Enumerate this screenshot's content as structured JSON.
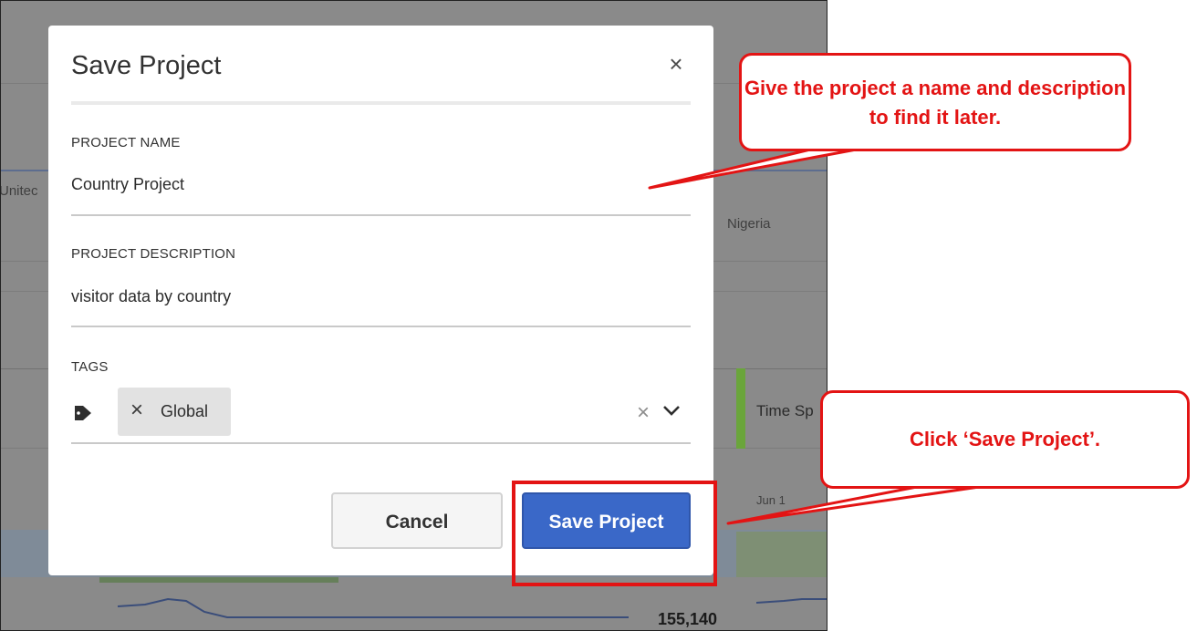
{
  "background": {
    "partial_country_label": "Unitec",
    "country_label": "Nigeria",
    "time_label": "Time Sp",
    "date_label": "Jun 1",
    "metric_value": "155,140"
  },
  "dialog": {
    "title": "Save Project",
    "close_icon": "close-icon",
    "project_name": {
      "label": "PROJECT NAME",
      "value": "Country Project"
    },
    "project_description": {
      "label": "PROJECT DESCRIPTION",
      "value": "visitor data by country"
    },
    "tags": {
      "label": "TAGS",
      "icon": "tag-icon",
      "items": [
        {
          "label": "Global"
        }
      ],
      "clear_icon": "clear-icon",
      "dropdown_icon": "chevron-down-icon"
    },
    "buttons": {
      "cancel_label": "Cancel",
      "save_label": "Save Project"
    }
  },
  "annotations": {
    "callout_top": "Give the project a name and description to find it later.",
    "callout_bottom": "Click ‘Save Project’.",
    "accent_color": "#e31414"
  },
  "colors": {
    "primary_button": "#3a68c8",
    "overlay": "#8a8a8a"
  }
}
